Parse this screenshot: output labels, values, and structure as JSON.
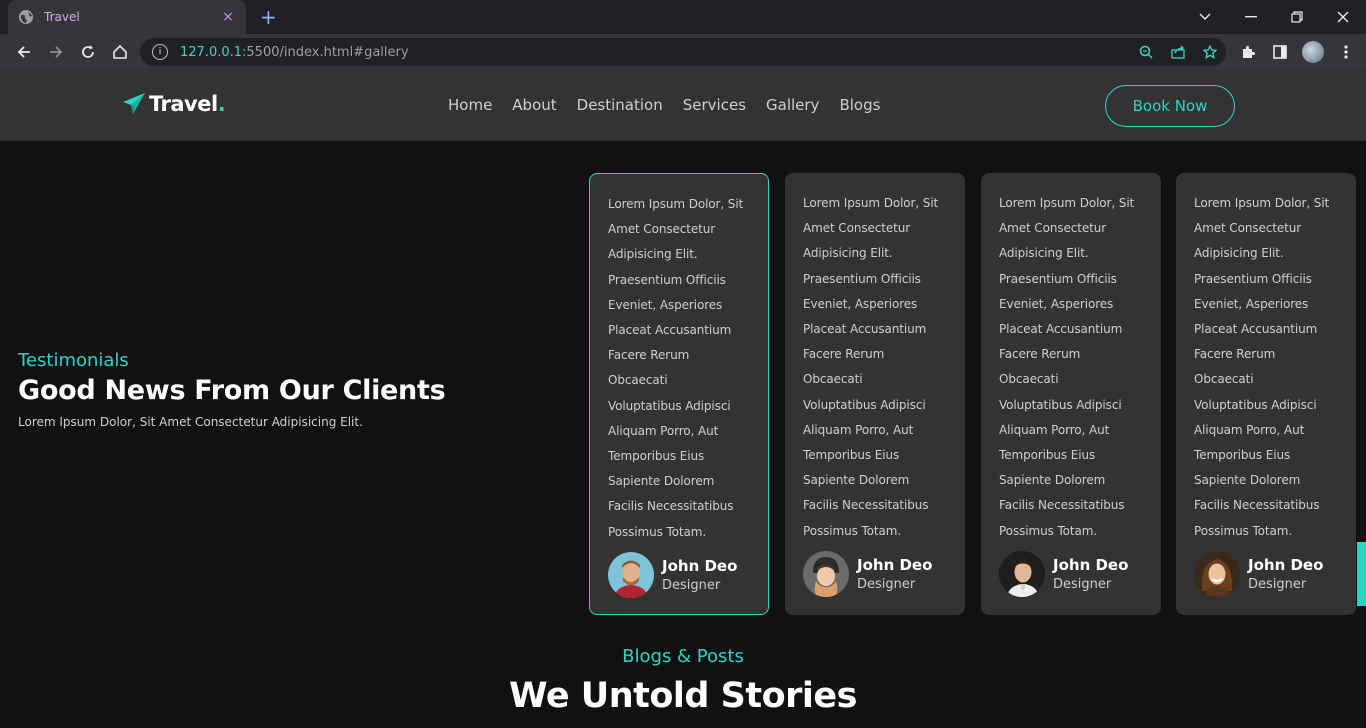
{
  "browser": {
    "tab_title": "Travel",
    "tab_close": "×",
    "new_tab": "+",
    "url_host": "127.0.0.1",
    "url_rest": ":5500/index.html#gallery"
  },
  "header": {
    "logo_text": "Travel",
    "logo_dot": ".",
    "nav": [
      "Home",
      "About",
      "Destination",
      "Services",
      "Gallery",
      "Blogs"
    ],
    "book_label": "Book Now"
  },
  "testimonials": {
    "kicker": "Testimonials",
    "title": "Good News From Our Clients",
    "subtitle": "Lorem Ipsum Dolor, Sit Amet Consectetur Adipisicing Elit.",
    "cards": [
      {
        "lines": [
          "Lorem Ipsum Dolor, Sit",
          "Amet Consectetur",
          "Adipisicing Elit.",
          "Praesentium Officiis",
          "Eveniet, Asperiores",
          "Placeat Accusantium",
          "Facere Rerum",
          "Obcaecati",
          "Voluptatibus Adipisci",
          "Aliquam Porro, Aut",
          "Temporibus Eius",
          "Sapiente Dolorem",
          "Facilis Necessitatibus",
          "Possimus Totam."
        ],
        "name": "John Deo",
        "role": "Designer"
      },
      {
        "lines": [
          "Lorem Ipsum Dolor, Sit",
          "Amet Consectetur",
          "Adipisicing Elit.",
          "Praesentium Officiis",
          "Eveniet, Asperiores",
          "Placeat Accusantium",
          "Facere Rerum",
          "Obcaecati",
          "Voluptatibus Adipisci",
          "Aliquam Porro, Aut",
          "Temporibus Eius",
          "Sapiente Dolorem",
          "Facilis Necessitatibus",
          "Possimus Totam."
        ],
        "name": "John Deo",
        "role": "Designer"
      },
      {
        "lines": [
          "Lorem Ipsum Dolor, Sit",
          "Amet Consectetur",
          "Adipisicing Elit.",
          "Praesentium Officiis",
          "Eveniet, Asperiores",
          "Placeat Accusantium",
          "Facere Rerum",
          "Obcaecati",
          "Voluptatibus Adipisci",
          "Aliquam Porro, Aut",
          "Temporibus Eius",
          "Sapiente Dolorem",
          "Facilis Necessitatibus",
          "Possimus Totam."
        ],
        "name": "John Deo",
        "role": "Designer"
      },
      {
        "lines": [
          "Lorem Ipsum Dolor, Sit",
          "Amet Consectetur",
          "Adipisicing Elit.",
          "Praesentium Officiis",
          "Eveniet, Asperiores",
          "Placeat Accusantium",
          "Facere Rerum",
          "Obcaecati",
          "Voluptatibus Adipisci",
          "Aliquam Porro, Aut",
          "Temporibus Eius",
          "Sapiente Dolorem",
          "Facilis Necessitatibus",
          "Possimus Totam."
        ],
        "name": "John Deo",
        "role": "Designer"
      }
    ]
  },
  "blogs": {
    "kicker": "Blogs & Posts",
    "title": "We Untold Stories"
  },
  "colors": {
    "accent": "#2bd4c6",
    "page_bg": "#111111",
    "card_bg": "#333333"
  }
}
